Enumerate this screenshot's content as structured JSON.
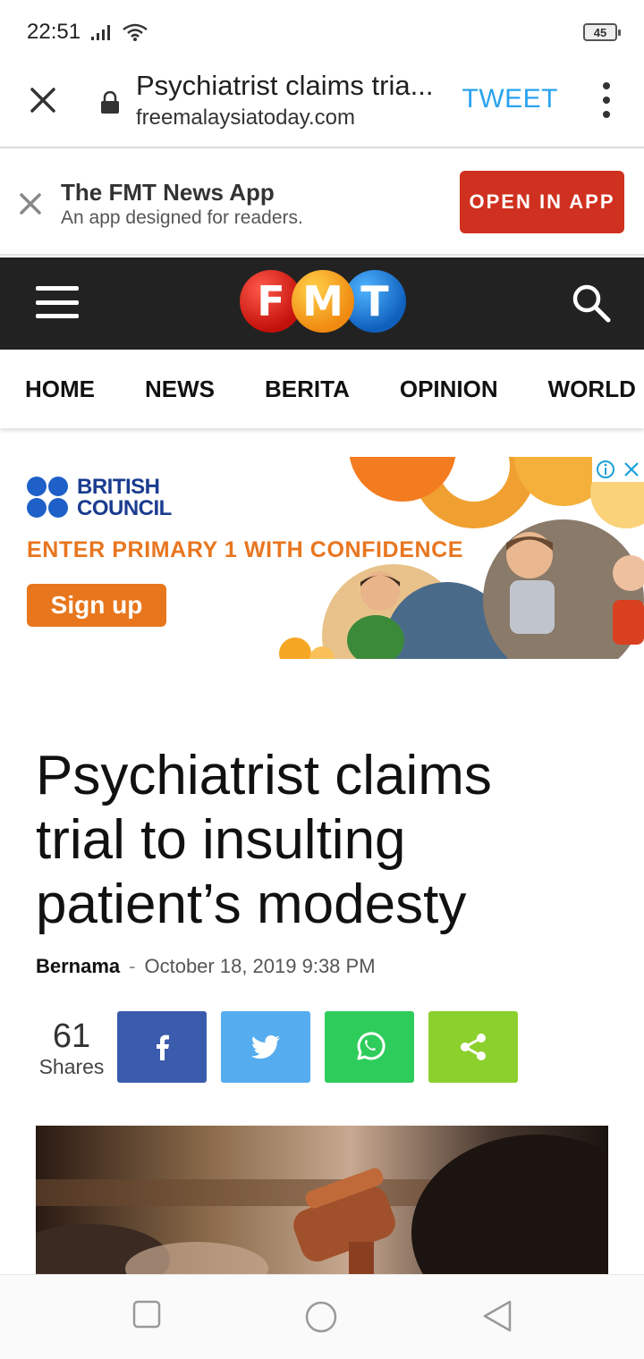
{
  "status_bar": {
    "time": "22:51",
    "battery": "45"
  },
  "custom_tab": {
    "title": "Psychiatrist claims tria...",
    "url": "freemalaysiatoday.com",
    "tweet_label": "TWEET"
  },
  "app_banner": {
    "title": "The FMT News App",
    "subtitle": "An app designed for readers.",
    "button_label": "OPEN IN APP"
  },
  "header": {
    "logo_letters": [
      "F",
      "M",
      "T"
    ]
  },
  "nav": {
    "items": [
      {
        "label": "HOME"
      },
      {
        "label": "NEWS"
      },
      {
        "label": "BERITA"
      },
      {
        "label": "OPINION"
      },
      {
        "label": "WORLD"
      }
    ]
  },
  "ad": {
    "brand_line1": "BRITISH",
    "brand_line2": "COUNCIL",
    "headline": "ENTER PRIMARY 1 WITH CONFIDENCE",
    "cta": "Sign up"
  },
  "article": {
    "headline": "Psychiatrist claims trial to insulting patient’s modesty",
    "author": "Bernama",
    "separator": "-",
    "date": "October 18, 2019 9:38 PM",
    "share_count": "61",
    "share_label": "Shares"
  },
  "colors": {
    "tweet": "#2aa3ef",
    "open_app": "#d0301f",
    "header_bg": "#222222",
    "facebook": "#3b5cad",
    "twitter": "#55acee",
    "whatsapp": "#2ecc5a",
    "share": "#8cd02e",
    "ad_orange": "#e8761c"
  }
}
